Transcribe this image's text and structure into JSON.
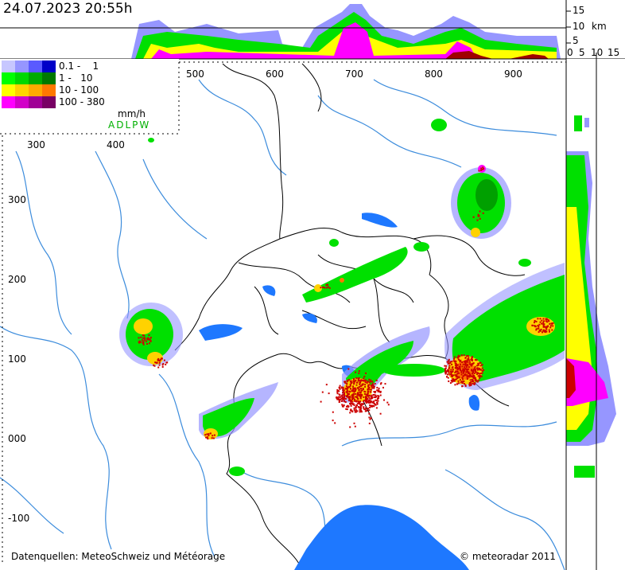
{
  "header": {
    "timestamp": "24.07.2023 20:55h"
  },
  "legend": {
    "rows": [
      {
        "label": "0.1 -    1",
        "colors": [
          "#c7c7ff",
          "#9696ff",
          "#5a5aff",
          "#0000c8"
        ]
      },
      {
        "label": "1 -   10",
        "colors": [
          "#00ff00",
          "#00d800",
          "#00aa00",
          "#007800"
        ]
      },
      {
        "label": "10 - 100",
        "colors": [
          "#ffff00",
          "#ffd200",
          "#ffaa00",
          "#ff7800"
        ]
      },
      {
        "label": "100 - 380",
        "colors": [
          "#ff00ff",
          "#d200c8",
          "#a00096",
          "#780064"
        ]
      }
    ],
    "unit": "mm/h",
    "stations": "ADLPW"
  },
  "axes": {
    "x_top": [
      "500",
      "600",
      "700",
      "800",
      "900"
    ],
    "x_inner": [
      "300",
      "400"
    ],
    "y_left": [
      "300",
      "200",
      "100",
      "000",
      "-100"
    ],
    "height_scale": [
      "15",
      "10",
      "5",
      "0"
    ],
    "height_unit": "km",
    "side_scale": [
      "0",
      "5",
      "10",
      "15"
    ]
  },
  "footer": {
    "sources": "Datenquellen: MeteoSchweiz und Météorage",
    "copyright": "© meteoradar 2011"
  },
  "colors": {
    "water": "#1e78ff",
    "rivers": "#3c8cdc",
    "borders": "#000000",
    "green": "#00e000",
    "yellow": "#ffff00",
    "magenta": "#ff00ff",
    "lightning": "#cc0000"
  }
}
